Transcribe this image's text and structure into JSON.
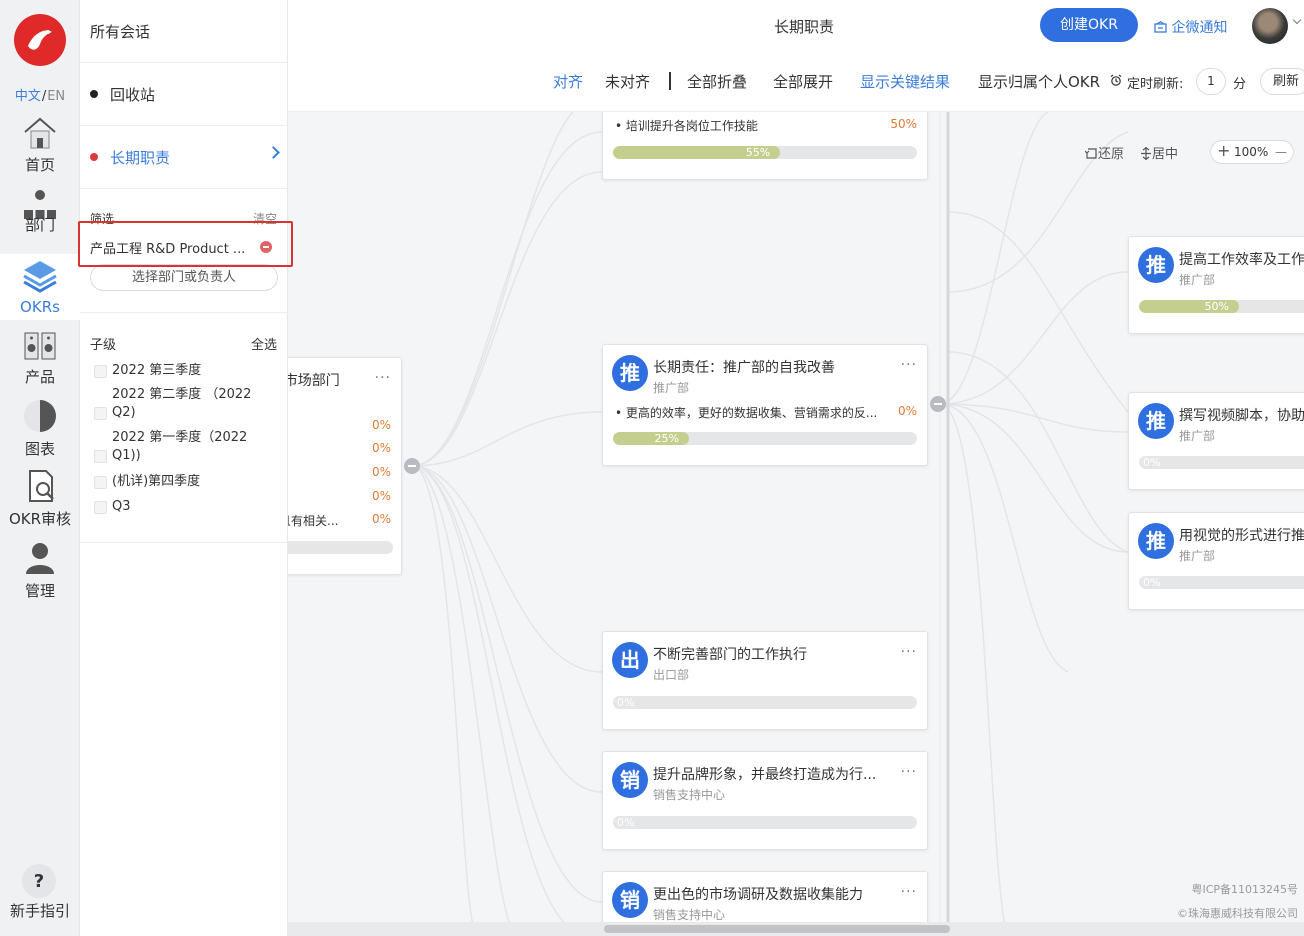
{
  "rail": {
    "lang_zh": "中文",
    "lang_sep": "/",
    "lang_en": "EN",
    "items": [
      {
        "label": "首页",
        "icon": "home-icon"
      },
      {
        "label": "部门",
        "icon": "department-icon"
      },
      {
        "label": "OKRs",
        "icon": "layers-icon",
        "active": true
      },
      {
        "label": "产品",
        "icon": "product-icon"
      },
      {
        "label": "图表",
        "icon": "pie-chart-icon"
      },
      {
        "label": "OKR审核",
        "icon": "review-icon"
      },
      {
        "label": "管理",
        "icon": "user-icon"
      }
    ],
    "help_label": "新手指引",
    "help_glyph": "?"
  },
  "panel": {
    "all_sessions": "所有会话",
    "recycle": "回收站",
    "long_term": "长期职责",
    "filter_label": "筛选",
    "clear_label": "清空",
    "filter_tag": "产品工程 R&D Product ...",
    "select_button": "选择部门或负责人",
    "children_label": "子级",
    "select_all": "全选",
    "quarters": [
      "2022 第三季度",
      "2022 第二季度 （2022 Q2)",
      "2022 第一季度（2022 Q1))",
      "(机详)第四季度",
      "Q3"
    ]
  },
  "header": {
    "title": "长期职责",
    "create_button": "创建OKR",
    "notify": "企微通知",
    "toolbar": {
      "align": "对齐",
      "unaligned": "未对齐",
      "collapse_all": "全部折叠",
      "expand_all": "全部展开",
      "show_kr": "显示关键结果",
      "show_personal": "显示归属个人OKR",
      "timer_label": "定时刷新:",
      "interval": "1",
      "unit": "分",
      "refresh": "刷新"
    }
  },
  "view": {
    "restore": "还原",
    "center": "居中",
    "zoom": "100%",
    "plus": "+",
    "minus": "—"
  },
  "cards": {
    "left": {
      "title": "/市场部门",
      "kr_pcts": [
        "0%",
        "0%",
        "0%",
        "0%",
        "0%"
      ],
      "last_kr": "且有相关..."
    },
    "top": {
      "kr": "培训提升各岗位工作技能",
      "kr_pct": "50%",
      "progress": 0.55,
      "progress_label": "55%"
    },
    "main": {
      "avatar": "推",
      "title": "长期责任：推广部的自我改善",
      "dept": "推广部",
      "kr": "更高的效率，更好的数据收集、营销需求的反...",
      "kr_pct": "0%",
      "progress": 0.25,
      "progress_label": "25%"
    },
    "chukou": {
      "avatar": "出",
      "title": "不断完善部门的工作执行",
      "dept": "出口部",
      "progress": 0,
      "progress_label": "0%"
    },
    "brand": {
      "avatar": "销",
      "title": "提升品牌形象，并最终打造成为行...",
      "dept": "销售支持中心",
      "progress": 0,
      "progress_label": "0%"
    },
    "market": {
      "avatar": "销",
      "title": "更出色的市场调研及数据收集能力",
      "dept": "销售支持中心"
    },
    "r1": {
      "avatar": "推",
      "title": "提高工作效率及工作",
      "dept": "推广部",
      "progress": 0.5,
      "progress_label": "50%"
    },
    "r2": {
      "avatar": "推",
      "title": "撰写视频脚本，协助",
      "dept": "推广部",
      "progress": 0,
      "progress_label": "0%"
    },
    "r3": {
      "avatar": "推",
      "title": "用视觉的形式进行推",
      "dept": "推广部",
      "progress": 0,
      "progress_label": "0%"
    }
  },
  "more_glyph": "···",
  "footer": {
    "icp": "粤ICP备11013245号",
    "copyright": "©珠海惠威科技有限公司"
  },
  "colors": {
    "accent": "#2f6fe0",
    "progress": "#c4cf8f",
    "danger": "#d9342f",
    "logo": "#e02a2a"
  }
}
